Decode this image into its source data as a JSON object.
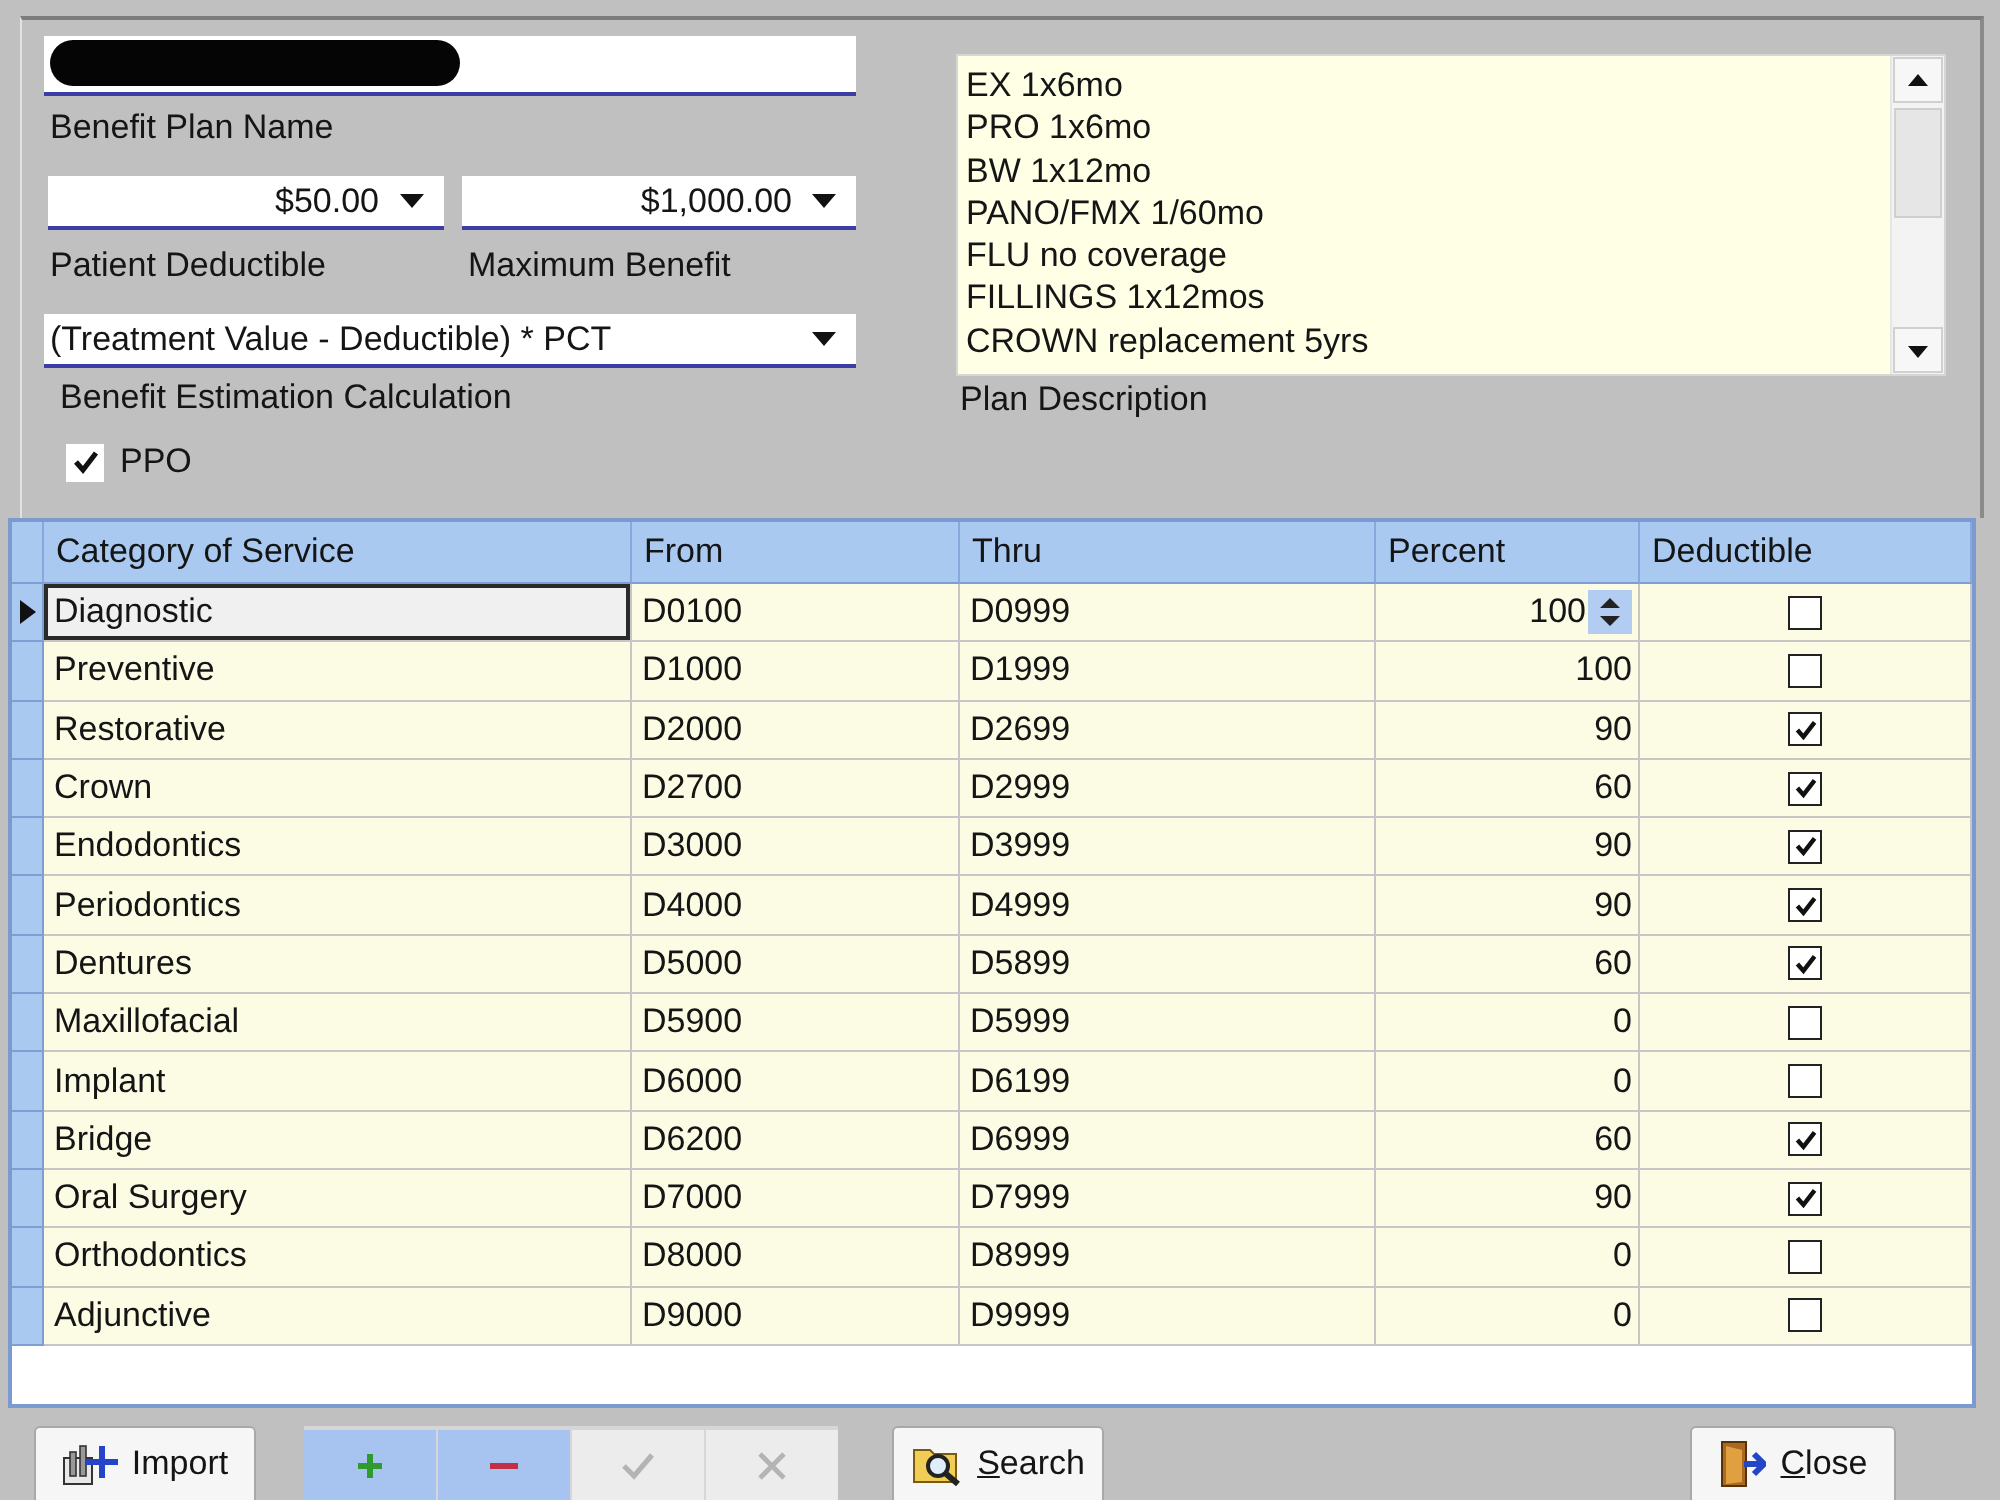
{
  "plan_name": {
    "label": "Benefit Plan Name",
    "redacted": true
  },
  "deductible": {
    "value": "$50.00",
    "label": "Patient Deductible"
  },
  "maximum_benefit": {
    "value": "$1,000.00",
    "label": "Maximum Benefit"
  },
  "calculation": {
    "value": "(Treatment Value - Deductible) * PCT",
    "label": "Benefit Estimation Calculation"
  },
  "ppo": {
    "label": "PPO",
    "checked": true
  },
  "plan_description": {
    "lines": [
      "EX 1x6mo",
      "PRO 1x6mo",
      "BW 1x12mo",
      "PANO/FMX 1/60mo",
      "FLU no coverage",
      "FILLINGS 1x12mos",
      "CROWN replacement 5yrs"
    ],
    "label": "Plan Description"
  },
  "grid": {
    "columns": [
      "Category of Service",
      "From",
      "Thru",
      "Percent",
      "Deductible"
    ],
    "rows": [
      {
        "category": "Diagnostic",
        "from": "D0100",
        "thru": "D0999",
        "percent": "100",
        "deductible": false,
        "selected": true
      },
      {
        "category": "Preventive",
        "from": "D1000",
        "thru": "D1999",
        "percent": "100",
        "deductible": false,
        "selected": false
      },
      {
        "category": "Restorative",
        "from": "D2000",
        "thru": "D2699",
        "percent": "90",
        "deductible": true,
        "selected": false
      },
      {
        "category": "Crown",
        "from": "D2700",
        "thru": "D2999",
        "percent": "60",
        "deductible": true,
        "selected": false
      },
      {
        "category": "Endodontics",
        "from": "D3000",
        "thru": "D3999",
        "percent": "90",
        "deductible": true,
        "selected": false
      },
      {
        "category": "Periodontics",
        "from": "D4000",
        "thru": "D4999",
        "percent": "90",
        "deductible": true,
        "selected": false
      },
      {
        "category": "Dentures",
        "from": "D5000",
        "thru": "D5899",
        "percent": "60",
        "deductible": true,
        "selected": false
      },
      {
        "category": "Maxillofacial",
        "from": "D5900",
        "thru": "D5999",
        "percent": "0",
        "deductible": false,
        "selected": false
      },
      {
        "category": "Implant",
        "from": "D6000",
        "thru": "D6199",
        "percent": "0",
        "deductible": false,
        "selected": false
      },
      {
        "category": "Bridge",
        "from": "D6200",
        "thru": "D6999",
        "percent": "60",
        "deductible": true,
        "selected": false
      },
      {
        "category": "Oral Surgery",
        "from": "D7000",
        "thru": "D7999",
        "percent": "90",
        "deductible": true,
        "selected": false
      },
      {
        "category": "Orthodontics",
        "from": "D8000",
        "thru": "D8999",
        "percent": "0",
        "deductible": false,
        "selected": false
      },
      {
        "category": "Adjunctive",
        "from": "D9000",
        "thru": "D9999",
        "percent": "0",
        "deductible": false,
        "selected": false
      }
    ]
  },
  "toolbar": [
    {
      "kind": "import",
      "label": "Import",
      "disabled": false,
      "mnemonic": false
    },
    {
      "kind": "add",
      "disabled": false
    },
    {
      "kind": "remove",
      "disabled": false
    },
    {
      "kind": "confirm",
      "disabled": true
    },
    {
      "kind": "cancel",
      "disabled": true
    },
    {
      "kind": "search",
      "label": "Search",
      "disabled": false,
      "mnemonic": true
    },
    {
      "kind": "close",
      "label": "Close",
      "disabled": false,
      "mnemonic": true
    }
  ]
}
